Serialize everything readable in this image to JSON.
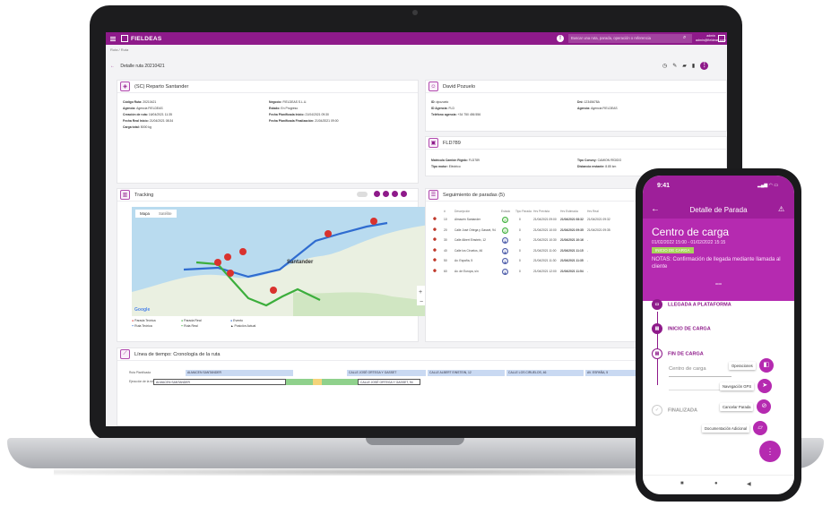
{
  "app": {
    "logo": "FIELDEAS",
    "search_placeholder": "Buscar una ruta, parada, operación o referencia",
    "user_name": "admin",
    "user_email": "admin@fieldeas.com",
    "breadcrumb": "Ruta  /  Ruta",
    "page_title": "Detalle ruta 20210421"
  },
  "route_card": {
    "title": "(SC) Reparto Santander",
    "left": [
      {
        "k": "Código Ruta:",
        "v": "20210421"
      },
      {
        "k": "Agencia:",
        "v": "Agencia FIELDEAS"
      },
      {
        "k": "Creación de ruta:",
        "v": "16/04/2021 11:35"
      },
      {
        "k": "Fecha Real Inicio:",
        "v": "21/04/2021 08:34"
      },
      {
        "k": "Carga total:",
        "v": "5000 kg"
      }
    ],
    "right": [
      {
        "k": "Negocio:",
        "v": "FIELDEAS S.L.U."
      },
      {
        "k": "Estado:",
        "v": "En Progreso"
      },
      {
        "k": "Fecha Planificada Inicio:",
        "v": "21/04/2021 09:30"
      },
      {
        "k": "Fecha Planificada Finalización:",
        "v": "21/04/2021 09:00"
      }
    ]
  },
  "driver_card": {
    "title": "David Pozuelo",
    "left": [
      {
        "k": "ID:",
        "v": "dpozuelo"
      },
      {
        "k": "ID Agencia:",
        "v": "FLD"
      },
      {
        "k": "Teléfono agencia:",
        "v": "+34 750 456 556"
      }
    ],
    "right": [
      {
        "k": "Dni:",
        "v": "12345678A"
      },
      {
        "k": "Agencia:",
        "v": "Agencia FIELDEAS"
      }
    ]
  },
  "vehicle_card": {
    "title": "FLD789",
    "left": [
      {
        "k": "Matrícula Camión Rígido:",
        "v": "FLD789"
      },
      {
        "k": "Tipo motor:",
        "v": "Eléctrico"
      }
    ],
    "right": [
      {
        "k": "Tipo Convoy:",
        "v": "CAMION RÍGIDO"
      },
      {
        "k": "Distancia restante:",
        "v": "8.85 km"
      }
    ]
  },
  "tracking": {
    "title": "Tracking",
    "tab_map": "Mapa",
    "tab_sat": "Satélite",
    "city": "Santander",
    "google": "Google",
    "legend": [
      "Parada Teórica",
      "Parada Real",
      "Evento",
      "Ruta Teórica",
      "Ruta Real",
      "Posición Actual"
    ]
  },
  "stops": {
    "title": "Seguimiento de paradas (5)",
    "headers": [
      "#",
      "Descripción",
      "Estado",
      "Tipo Parada",
      "Hrs Prevista",
      "Hrs Estimada",
      "Hrs Real"
    ],
    "rows": [
      {
        "n": "10",
        "desc": "Almacén Santander",
        "status": "ok",
        "tipo": "0",
        "prev": "21/04/2021 09:00",
        "est": "21/04/2021 08:32",
        "real": "21/04/2021 09:32"
      },
      {
        "n": "20",
        "desc": "Calle José Ortega y Gasset, 94",
        "status": "ok",
        "tipo": "0",
        "prev": "21/04/2021 10:00",
        "est": "21/04/2021 09:35",
        "real": "21/04/2021 09:35"
      },
      {
        "n": "30",
        "desc": "Calle Albert Einstein, 12",
        "status": "pending",
        "tipo": "0",
        "prev": "21/04/2021 10:30",
        "est": "21/04/2021 10:16",
        "real": "-"
      },
      {
        "n": "40",
        "desc": "Calle los Ciruelos, 46",
        "status": "pending",
        "tipo": "0",
        "prev": "21/04/2021 11:00",
        "est": "21/04/2021 11:15",
        "real": "-"
      },
      {
        "n": "50",
        "desc": "Av. España, 5",
        "status": "pending",
        "tipo": "0",
        "prev": "21/04/2021 11:30",
        "est": "21/04/2021 11:35",
        "real": "-"
      },
      {
        "n": "60",
        "desc": "Av. de Europa, s/n",
        "status": "pending",
        "tipo": "0",
        "prev": "21/04/2021 12:00",
        "est": "21/04/2021 11:54",
        "real": "-"
      }
    ]
  },
  "timeline": {
    "title": "Línea de tiempo: Cronología de la ruta",
    "row1_label": "Ruta Planificada",
    "row2_label": "Ejecución de la ruta",
    "planned": [
      "ALMACEN SANTANDER",
      "CALLE JOSÉ ORTEGA Y GASSET",
      "CALLE ALBERT EINSTEIN, 12",
      "CALLE LOS CIRUELOS, 46",
      "AV. ESPAÑA, 5"
    ],
    "actual": [
      "ALMACEN SANTANDER",
      "CALLE JOSÉ ORTEGA Y GASSET, 94"
    ]
  },
  "phone": {
    "time": "9:41",
    "nav_title": "Detalle de Parada",
    "place": "Centro de carga",
    "window": "01/02/2022 15:00 - 01/02/2022 15:15",
    "badge": "INICIO DE CARGA",
    "notes": "NOTAS: Confirmación de llegada mediante llamada al cliente",
    "more": "ooo",
    "steps": [
      "LLEGADA A PLATAFORMA",
      "INICIO DE CARGA",
      "FIN DE CARGA",
      "FINALIZADA"
    ],
    "input_label": "Centro de carga",
    "actions": [
      "Operaciones",
      "Navegación GPS",
      "Cancelar Parada",
      "Documentación Adicional"
    ]
  }
}
